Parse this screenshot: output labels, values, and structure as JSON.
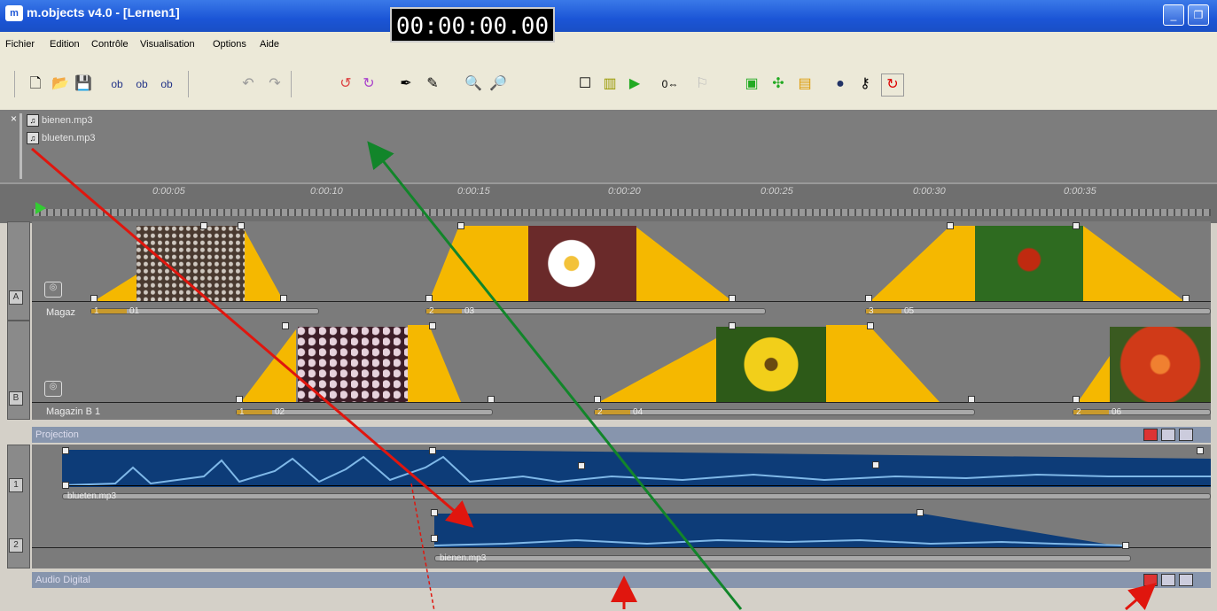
{
  "window": {
    "title": "m.objects v4.0 - [Lernen1]",
    "app_icon": "m.objects-icon",
    "timecode": "00:00:00.00"
  },
  "menu": [
    "Fichier",
    "Edition",
    "Contrôle",
    "Visualisation",
    "Options",
    "Aide"
  ],
  "toolbar": {
    "icons": [
      "new-icon",
      "open-icon",
      "save-icon",
      "obj-add-icon",
      "obj-add2-icon",
      "obj-icon",
      "undo-icon",
      "redo-icon",
      "rotate-left-icon",
      "rotate-right-icon",
      "wand-icon",
      "pen-icon",
      "zoom-in-icon",
      "zoom-out-icon",
      "frame-icon",
      "film-icon",
      "play-icon",
      "counter-icon",
      "marker-icon",
      "image-green-icon",
      "image-move-icon",
      "book-icon",
      "dots-icon",
      "key-icon",
      "loop-icon"
    ]
  },
  "object_list": {
    "items": [
      "bienen.mp3",
      "blueten.mp3"
    ]
  },
  "ruler": {
    "labels": [
      "0:00:05",
      "0:00:10",
      "0:00:15",
      "0:00:20",
      "0:00:25",
      "0:00:30",
      "0:00:35"
    ]
  },
  "projection": {
    "section_label": "Projection",
    "tracks": [
      {
        "letter": "A",
        "name": "Magaz",
        "bars": [
          "1",
          "2",
          "3"
        ],
        "slide_numbers": [
          "01",
          "03",
          "05"
        ]
      },
      {
        "letter": "B",
        "name": "Magazin B 1",
        "bars": [
          "1",
          "2",
          "2"
        ],
        "slide_numbers": [
          "02",
          "04",
          "06"
        ]
      }
    ]
  },
  "audio": {
    "section_label": "Audio Digital",
    "tracks": [
      {
        "number": "1",
        "clip": "blueten.mp3"
      },
      {
        "number": "2",
        "clip": "bienen.mp3"
      }
    ]
  },
  "colors": {
    "fade": "#f5b800",
    "wave": "#0d3c78",
    "wave_light": "#7fb8e8",
    "annotation_red": "#e0160e",
    "annotation_green": "#12852a"
  }
}
